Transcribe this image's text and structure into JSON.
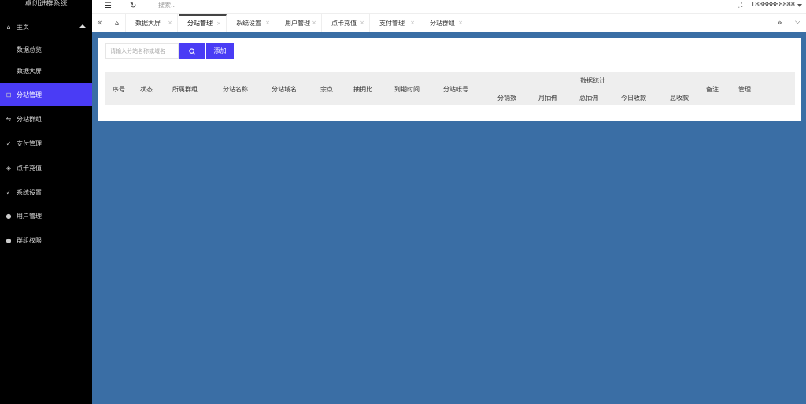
{
  "app": {
    "brand": "卓创进群系统"
  },
  "sidebar": {
    "items": [
      {
        "label": "主页",
        "icon": "home-icon",
        "glyph": "⌂"
      },
      {
        "label": "数据总览"
      },
      {
        "label": "数据大屏"
      },
      {
        "label": "分站管理",
        "icon": "branch-icon",
        "glyph": "⊡",
        "active": true
      },
      {
        "label": "分站群组",
        "icon": "group-arrows-icon",
        "glyph": "⇋"
      },
      {
        "label": "支付管理",
        "icon": "check-circle-icon",
        "glyph": "✓"
      },
      {
        "label": "点卡充值",
        "icon": "shield-icon",
        "glyph": "◈"
      },
      {
        "label": "系统设置",
        "icon": "check-circle-icon",
        "glyph": "✓"
      },
      {
        "label": "用户管理",
        "icon": "user-icon",
        "glyph": "●"
      },
      {
        "label": "群组权限",
        "icon": "users-icon",
        "glyph": "●"
      }
    ]
  },
  "topbar": {
    "search_placeholder": "搜索...",
    "user": "18888888888"
  },
  "tabs": [
    {
      "label": "数据大屏"
    },
    {
      "label": "分站管理",
      "active": true
    },
    {
      "label": "系统设置"
    },
    {
      "label": "用户管理"
    },
    {
      "label": "点卡充值"
    },
    {
      "label": "支付管理"
    },
    {
      "label": "分站群组"
    }
  ],
  "toolbar": {
    "search_placeholder": "请输入分站名称或域名",
    "add_label": "添加"
  },
  "table": {
    "columns": [
      "序号",
      "状态",
      "所属群组",
      "分站名称",
      "分站域名",
      "余点",
      "抽拥比",
      "到期时间",
      "分站帐号"
    ],
    "group_header": "数据统计",
    "sub_columns": [
      "分销数",
      "月抽佣",
      "总抽佣",
      "今日收款",
      "总收款"
    ],
    "tail_columns": [
      "备注",
      "管理"
    ]
  },
  "colors": {
    "accent": "#4a3cf5",
    "background": "#3a6ea5",
    "sidebar": "#000000"
  }
}
